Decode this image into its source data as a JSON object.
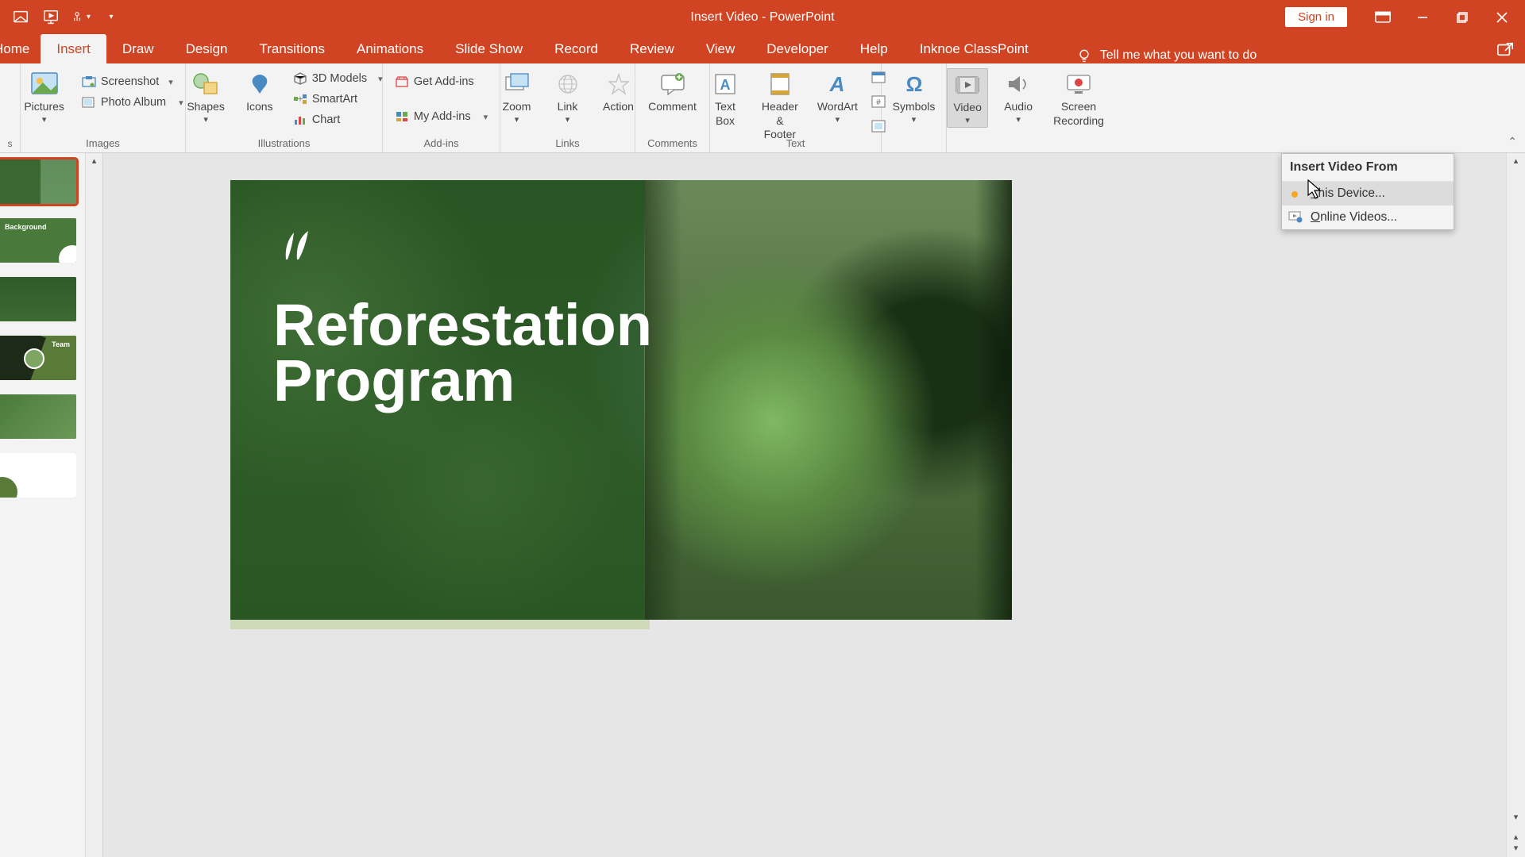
{
  "titlebar": {
    "title": "Insert Video  -  PowerPoint",
    "signin": "Sign in"
  },
  "tabs": {
    "home": "Home",
    "insert": "Insert",
    "draw": "Draw",
    "design": "Design",
    "transitions": "Transitions",
    "animations": "Animations",
    "slideshow": "Slide Show",
    "record": "Record",
    "review": "Review",
    "view": "View",
    "developer": "Developer",
    "help": "Help",
    "classpoint": "Inknoe ClassPoint",
    "tellme": "Tell me what you want to do"
  },
  "ribbon": {
    "images": {
      "label": "Images",
      "pictures": "Pictures",
      "screenshot": "Screenshot",
      "photoalbum": "Photo Album"
    },
    "illustrations": {
      "label": "Illustrations",
      "shapes": "Shapes",
      "icons": "Icons",
      "models3d": "3D Models",
      "smartart": "SmartArt",
      "chart": "Chart"
    },
    "addins": {
      "label": "Add-ins",
      "get": "Get Add-ins",
      "my": "My Add-ins"
    },
    "links": {
      "label": "Links",
      "zoom": "Zoom",
      "link": "Link",
      "action": "Action"
    },
    "comments": {
      "label": "Comments",
      "comment": "Comment"
    },
    "text": {
      "label": "Text",
      "textbox": "Text\nBox",
      "headerfooter": "Header\n& Footer",
      "wordart": "WordArt"
    },
    "symbols": {
      "label": "",
      "symbols": "Symbols"
    },
    "media": {
      "label": "",
      "video": "Video",
      "audio": "Audio",
      "screenrec": "Screen\nRecording"
    }
  },
  "slide": {
    "title_line1": "Reforestation",
    "title_line2": "Program"
  },
  "thumbs": {
    "t2_title": "Background",
    "t4_title": "Team"
  },
  "dropdown": {
    "header": "Insert Video From",
    "thisdevice_pre": "T",
    "thisdevice_rest": "his Device...",
    "online_pre": "O",
    "online_rest": "nline Videos..."
  }
}
